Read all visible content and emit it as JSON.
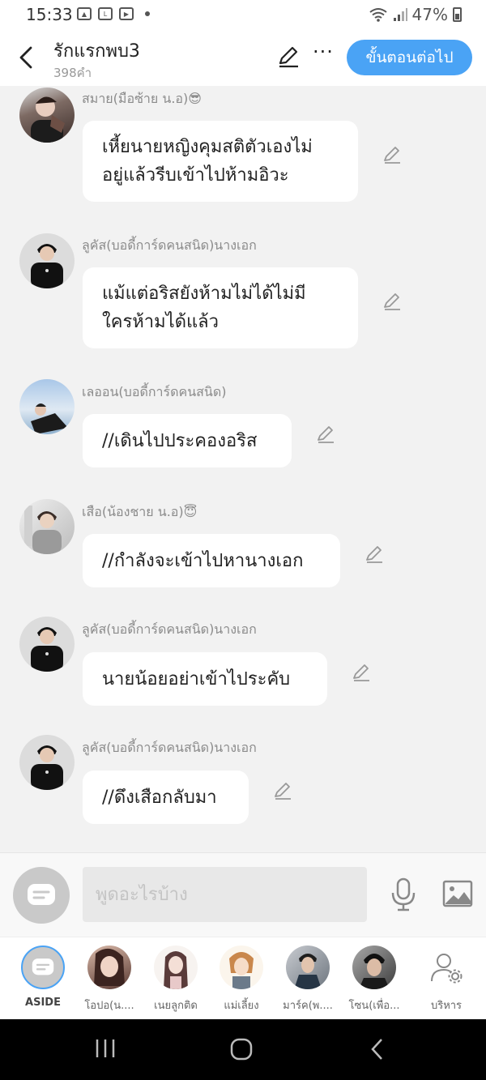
{
  "status_bar": {
    "time": "15:33",
    "battery": "47%"
  },
  "header": {
    "title": "รักแรกพบ3",
    "word_count": "398คำ",
    "next_button": "ขั้นตอนต่อไป"
  },
  "messages": [
    {
      "name": "สมาย(มือซ้าย น.อ)😎",
      "lines": [
        "เหี้ยนายหญิงคุมสติตัวเองไม่",
        "อยู่แล้วรีบเข้าไปห้ามอิวะ"
      ]
    },
    {
      "name": "ลูคัส(บอดี้การ์ดคนสนิด)นางเอก",
      "lines": [
        "แม้แต่อริสยังห้ามไม่ได้ไม่มี",
        "ใครห้ามได้แล้ว"
      ]
    },
    {
      "name": "เลออน(บอดี้การ์ดคนสนิด)",
      "lines": [
        "//เดินไปประคองอริส"
      ]
    },
    {
      "name": "เสือ(น้องชาย น.อ)😇",
      "lines": [
        "//กำลังจะเข้าไปหานางเอก"
      ]
    },
    {
      "name": "ลูคัส(บอดี้การ์ดคนสนิด)นางเอก",
      "lines": [
        "นายน้อยอย่าเข้าไประคับ"
      ]
    },
    {
      "name": "ลูคัส(บอดี้การ์ดคนสนิด)นางเอก",
      "lines": [
        "//ดึงเสือกลับมา"
      ]
    }
  ],
  "input": {
    "placeholder": "พูดอะไรบ้าง"
  },
  "characters": [
    {
      "label": "ASIDE"
    },
    {
      "label": "โอปอ(น...."
    },
    {
      "label": "เนยลูกติด"
    },
    {
      "label": "แม่เลี้ยง"
    },
    {
      "label": "มาร์ค(พ...."
    },
    {
      "label": "โซน(เพื่อ..."
    },
    {
      "label": "บริหาร"
    }
  ],
  "colors": {
    "accent": "#4aa3f5",
    "background": "#f2f2f2",
    "bubble": "#ffffff",
    "name_text": "#8b8b8b"
  }
}
